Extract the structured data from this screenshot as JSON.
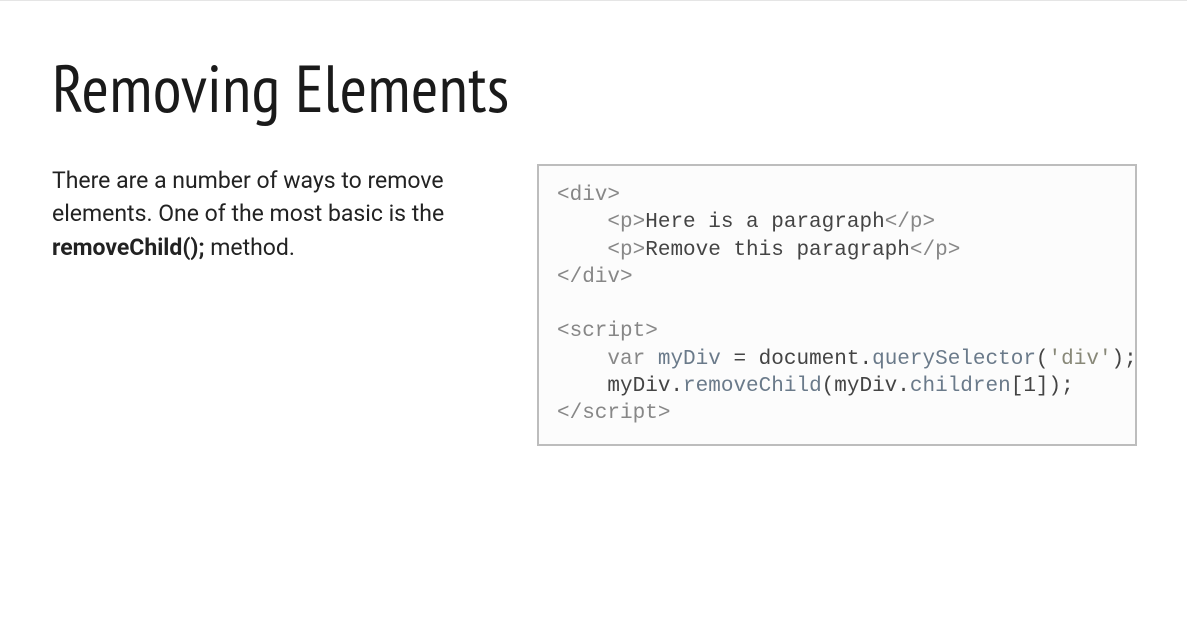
{
  "heading": "Removing Elements",
  "description": {
    "text_before": "There are a number of ways to remove elements. One of the most basic is the ",
    "bold_text": "removeChild();",
    "text_after": " method."
  },
  "code": {
    "line1_open": "<div>",
    "line2_indent": "    ",
    "line2_open": "<p>",
    "line2_text": "Here is a paragraph",
    "line2_close": "</p>",
    "line3_indent": "    ",
    "line3_open": "<p>",
    "line3_text": "Remove this paragraph",
    "line3_close": "</p>",
    "line4_close": "</div>",
    "blank": "",
    "line5_open": "<script>",
    "line6_indent": "    ",
    "line6_kw": "var",
    "line6_sp1": " ",
    "line6_name": "myDiv",
    "line6_eq": " = document.",
    "line6_qs": "querySelector",
    "line6_paren_open": "(",
    "line6_str": "'div'",
    "line6_paren_close": ");",
    "line7_indent": "    ",
    "line7_obj": "myDiv.",
    "line7_rc": "removeChild",
    "line7_arg_open": "(myDiv.",
    "line7_children": "children",
    "line7_idx": "[1]);",
    "line8_close": "</script>"
  }
}
